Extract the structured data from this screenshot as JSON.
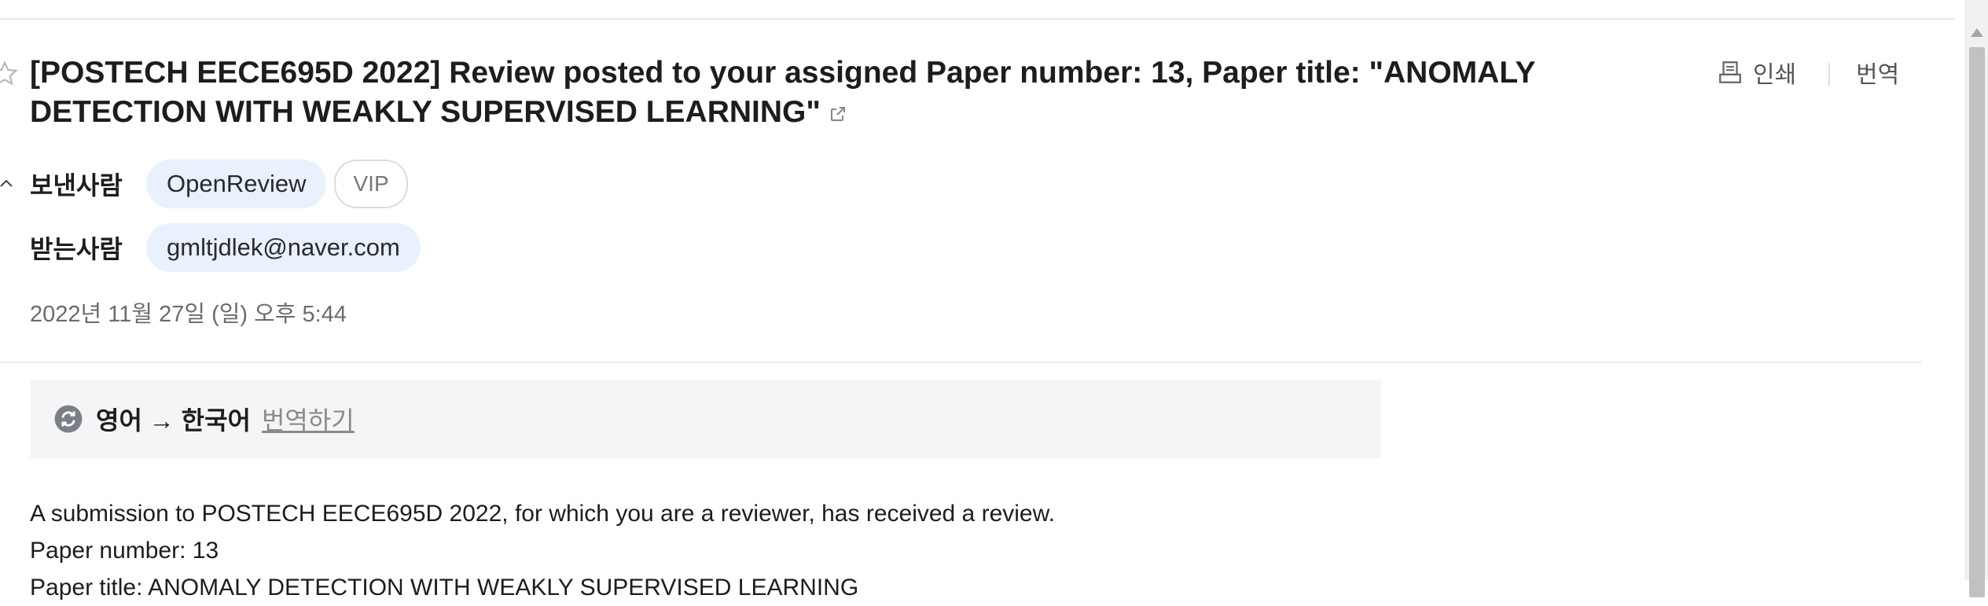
{
  "email": {
    "subject": "[POSTECH EECE695D 2022] Review posted to your assigned Paper number: 13, Paper title: \"ANOMALY DETECTION WITH WEAKLY SUPERVISED LEARNING\"",
    "print_label": "인쇄",
    "translate_label": "번역",
    "sender_label": "보낸사람",
    "sender_name": "OpenReview",
    "sender_badge": "VIP",
    "recipient_label": "받는사람",
    "recipient_email": "gmltjdlek@naver.com",
    "date": "2022년 11월 27일 (일) 오후 5:44"
  },
  "translation_bar": {
    "languages": "영어 → 한국어",
    "action_link": "번역하기"
  },
  "body_lines": [
    "A submission to POSTECH EECE695D 2022, for which you are a reviewer, has received a review.",
    "Paper number: 13",
    "Paper title: ANOMALY DETECTION WITH WEAKLY SUPERVISED LEARNING"
  ],
  "icons": {
    "star": "star-outline-icon",
    "external": "external-link-icon",
    "print": "printer-icon",
    "collapse": "chevron-up-icon",
    "translate": "translate-refresh-icon"
  },
  "colors": {
    "chip_bg": "#e8f1fd",
    "translation_bar_bg": "#f5f5f7",
    "text": "#1d1d1d",
    "muted": "#6b6b6b"
  }
}
